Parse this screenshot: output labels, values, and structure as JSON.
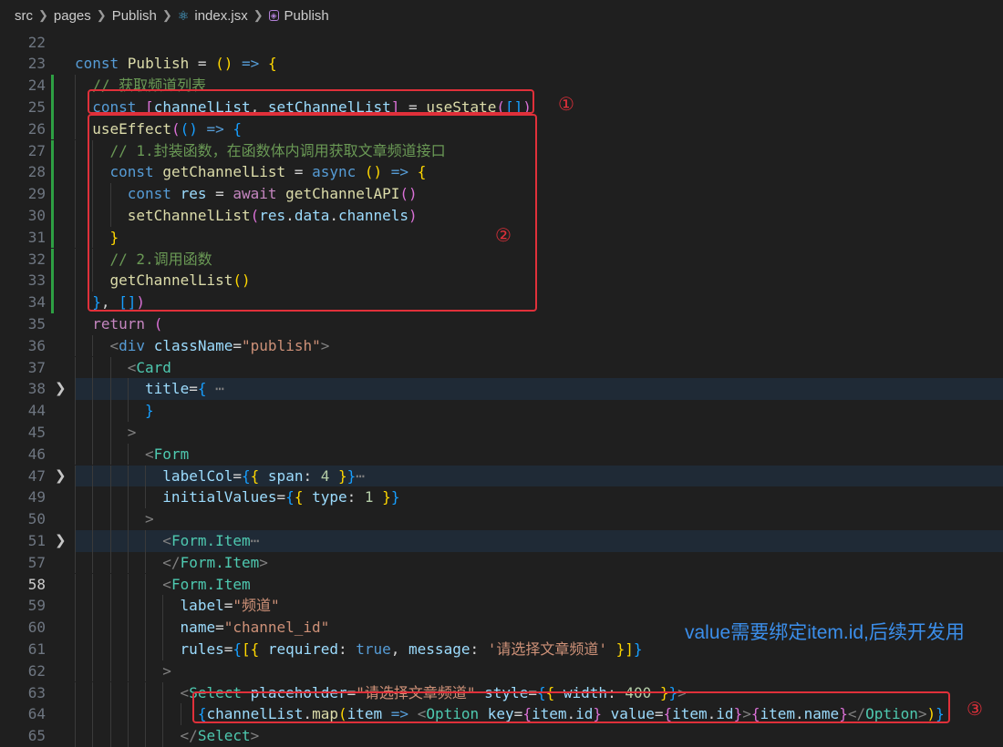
{
  "breadcrumb": {
    "src": "src",
    "pages": "pages",
    "folder": "Publish",
    "file": "index.jsx",
    "symbol": "Publish"
  },
  "lines": [
    {
      "n": "22"
    },
    {
      "n": "23",
      "t": [
        [
          "kw",
          "const "
        ],
        [
          "fn",
          "Publish"
        ],
        [
          "pl",
          " = "
        ],
        [
          "b1",
          "()"
        ],
        [
          "pl",
          " "
        ],
        [
          "kw",
          "=>"
        ],
        [
          "pl",
          " "
        ],
        [
          "b1",
          "{"
        ]
      ]
    },
    {
      "n": "24",
      "t": [
        [
          "cm",
          "// 获取频道列表"
        ]
      ]
    },
    {
      "n": "25",
      "t": [
        [
          "kw",
          "const "
        ],
        [
          "b2",
          "["
        ],
        [
          "id",
          "channelList"
        ],
        [
          "pl",
          ", "
        ],
        [
          "id",
          "setChannelList"
        ],
        [
          "b2",
          "]"
        ],
        [
          "pl",
          " = "
        ],
        [
          "fn",
          "useState"
        ],
        [
          "b2",
          "("
        ],
        [
          "b3",
          "[]"
        ],
        [
          "b2",
          ")"
        ]
      ]
    },
    {
      "n": "26",
      "t": [
        [
          "fn",
          "useEffect"
        ],
        [
          "b2",
          "("
        ],
        [
          "b3",
          "()"
        ],
        [
          "pl",
          " "
        ],
        [
          "kw",
          "=>"
        ],
        [
          "pl",
          " "
        ],
        [
          "b3",
          "{"
        ]
      ]
    },
    {
      "n": "27",
      "t": [
        [
          "cm",
          "// 1.封装函数，在函数体内调用获取文章频道接口"
        ]
      ]
    },
    {
      "n": "28",
      "t": [
        [
          "kw",
          "const "
        ],
        [
          "fn",
          "getChannelList"
        ],
        [
          "pl",
          " = "
        ],
        [
          "kw",
          "async"
        ],
        [
          "pl",
          " "
        ],
        [
          "b1",
          "()"
        ],
        [
          "pl",
          " "
        ],
        [
          "kw",
          "=>"
        ],
        [
          "pl",
          " "
        ],
        [
          "b1",
          "{"
        ]
      ]
    },
    {
      "n": "29",
      "t": [
        [
          "kw",
          "const "
        ],
        [
          "id",
          "res"
        ],
        [
          "pl",
          " = "
        ],
        [
          "ctl",
          "await "
        ],
        [
          "fn",
          "getChannelAPI"
        ],
        [
          "b2",
          "()"
        ]
      ]
    },
    {
      "n": "30",
      "t": [
        [
          "fn",
          "setChannelList"
        ],
        [
          "b2",
          "("
        ],
        [
          "id",
          "res"
        ],
        [
          "pl",
          "."
        ],
        [
          "id",
          "data"
        ],
        [
          "pl",
          "."
        ],
        [
          "id",
          "channels"
        ],
        [
          "b2",
          ")"
        ]
      ]
    },
    {
      "n": "31",
      "t": [
        [
          "b1",
          "}"
        ]
      ]
    },
    {
      "n": "32",
      "t": [
        [
          "cm",
          "// 2.调用函数"
        ]
      ]
    },
    {
      "n": "33",
      "t": [
        [
          "fn",
          "getChannelList"
        ],
        [
          "b1",
          "()"
        ]
      ]
    },
    {
      "n": "34",
      "t": [
        [
          "b3",
          "}"
        ],
        [
          "pl",
          ", "
        ],
        [
          "b3",
          "[]"
        ],
        [
          "b2",
          ")"
        ]
      ]
    },
    {
      "n": "35",
      "t": [
        [
          "ctl",
          "return "
        ],
        [
          "b2",
          "("
        ]
      ]
    },
    {
      "n": "36",
      "t": [
        [
          "tb",
          "<"
        ],
        [
          "kw",
          "div "
        ],
        [
          "at",
          "className"
        ],
        [
          "eq",
          "="
        ],
        [
          "str",
          "\"publish\""
        ],
        [
          "tb",
          ">"
        ]
      ]
    },
    {
      "n": "37",
      "t": [
        [
          "tb",
          "<"
        ],
        [
          "tag",
          "Card"
        ]
      ]
    },
    {
      "n": "38",
      "t": [
        [
          "at",
          "title"
        ],
        [
          "eq",
          "="
        ],
        [
          "b3",
          "{"
        ],
        [
          "tb",
          " ⋯"
        ]
      ]
    },
    {
      "n": "44",
      "t": [
        [
          "b3",
          "}"
        ]
      ]
    },
    {
      "n": "45",
      "t": [
        [
          "tb",
          ">"
        ]
      ]
    },
    {
      "n": "46",
      "t": [
        [
          "tb",
          "<"
        ],
        [
          "tag",
          "Form"
        ]
      ]
    },
    {
      "n": "47",
      "t": [
        [
          "at",
          "labelCol"
        ],
        [
          "eq",
          "="
        ],
        [
          "b3",
          "{"
        ],
        [
          "b1",
          "{"
        ],
        [
          "pl",
          " "
        ],
        [
          "id",
          "span"
        ],
        [
          "pl",
          ": "
        ],
        [
          "num",
          "4"
        ],
        [
          "pl",
          " "
        ],
        [
          "b1",
          "}"
        ],
        [
          "b3",
          "}"
        ],
        [
          "tb",
          "⋯"
        ]
      ]
    },
    {
      "n": "49",
      "t": [
        [
          "at",
          "initialValues"
        ],
        [
          "eq",
          "="
        ],
        [
          "b3",
          "{"
        ],
        [
          "b1",
          "{"
        ],
        [
          "pl",
          " "
        ],
        [
          "id",
          "type"
        ],
        [
          "pl",
          ": "
        ],
        [
          "num",
          "1"
        ],
        [
          "pl",
          " "
        ],
        [
          "b1",
          "}"
        ],
        [
          "b3",
          "}"
        ]
      ]
    },
    {
      "n": "50",
      "t": [
        [
          "tb",
          ">"
        ]
      ]
    },
    {
      "n": "51",
      "t": [
        [
          "tb",
          "<"
        ],
        [
          "tag",
          "Form.Item"
        ],
        [
          "tb",
          "⋯"
        ]
      ]
    },
    {
      "n": "57",
      "t": [
        [
          "tb",
          "</"
        ],
        [
          "tag",
          "Form.Item"
        ],
        [
          "tb",
          ">"
        ]
      ]
    },
    {
      "n": "58",
      "t": [
        [
          "tb",
          "<"
        ],
        [
          "tag",
          "Form.Item"
        ]
      ]
    },
    {
      "n": "59",
      "t": [
        [
          "at",
          "label"
        ],
        [
          "eq",
          "="
        ],
        [
          "str",
          "\"频道\""
        ]
      ]
    },
    {
      "n": "60",
      "t": [
        [
          "at",
          "name"
        ],
        [
          "eq",
          "="
        ],
        [
          "str",
          "\"channel_id\""
        ]
      ]
    },
    {
      "n": "61",
      "t": [
        [
          "at",
          "rules"
        ],
        [
          "eq",
          "="
        ],
        [
          "b3",
          "{"
        ],
        [
          "b1",
          "[{"
        ],
        [
          "pl",
          " "
        ],
        [
          "id",
          "required"
        ],
        [
          "pl",
          ": "
        ],
        [
          "kw",
          "true"
        ],
        [
          "pl",
          ", "
        ],
        [
          "id",
          "message"
        ],
        [
          "pl",
          ": "
        ],
        [
          "str",
          "'请选择文章频道'"
        ],
        [
          "pl",
          " "
        ],
        [
          "b1",
          "}]"
        ],
        [
          "b3",
          "}"
        ]
      ]
    },
    {
      "n": "62",
      "t": [
        [
          "tb",
          ">"
        ]
      ]
    },
    {
      "n": "63",
      "t": [
        [
          "tb",
          "<"
        ],
        [
          "tag",
          "Select "
        ],
        [
          "at",
          "placeholder"
        ],
        [
          "eq",
          "="
        ],
        [
          "str",
          "\"请选择文章频道\""
        ],
        [
          "pl",
          " "
        ],
        [
          "at",
          "style"
        ],
        [
          "eq",
          "="
        ],
        [
          "b3",
          "{"
        ],
        [
          "b1",
          "{"
        ],
        [
          "pl",
          " "
        ],
        [
          "id",
          "width"
        ],
        [
          "pl",
          ": "
        ],
        [
          "num",
          "400"
        ],
        [
          "pl",
          " "
        ],
        [
          "b1",
          "}"
        ],
        [
          "b3",
          "}"
        ],
        [
          "tb",
          ">"
        ]
      ]
    },
    {
      "n": "64",
      "t": [
        [
          "b3",
          "{"
        ],
        [
          "id",
          "channelList"
        ],
        [
          "pl",
          "."
        ],
        [
          "fn",
          "map"
        ],
        [
          "b1",
          "("
        ],
        [
          "id",
          "item"
        ],
        [
          "pl",
          " "
        ],
        [
          "kw",
          "=>"
        ],
        [
          "pl",
          " "
        ],
        [
          "tb",
          "<"
        ],
        [
          "tag",
          "Option "
        ],
        [
          "at",
          "key"
        ],
        [
          "eq",
          "="
        ],
        [
          "b2",
          "{"
        ],
        [
          "id",
          "item"
        ],
        [
          "pl",
          "."
        ],
        [
          "id",
          "id"
        ],
        [
          "b2",
          "}"
        ],
        [
          "pl",
          " "
        ],
        [
          "at",
          "value"
        ],
        [
          "eq",
          "="
        ],
        [
          "b2",
          "{"
        ],
        [
          "id",
          "item"
        ],
        [
          "pl",
          "."
        ],
        [
          "id",
          "id"
        ],
        [
          "b2",
          "}"
        ],
        [
          "tb",
          ">"
        ],
        [
          "b2",
          "{"
        ],
        [
          "id",
          "item"
        ],
        [
          "pl",
          "."
        ],
        [
          "id",
          "name"
        ],
        [
          "b2",
          "}"
        ],
        [
          "tb",
          "</"
        ],
        [
          "tag",
          "Option"
        ],
        [
          "tb",
          ">"
        ],
        [
          "b1",
          ")"
        ],
        [
          "b3",
          "}"
        ]
      ]
    },
    {
      "n": "65",
      "t": [
        [
          "tb",
          "</"
        ],
        [
          "tag",
          "Select"
        ],
        [
          "tb",
          ">"
        ]
      ]
    }
  ],
  "annotations": {
    "mark1": "①",
    "mark2": "②",
    "mark3": "③",
    "note": "value需要绑定item.id,后续开发用"
  }
}
